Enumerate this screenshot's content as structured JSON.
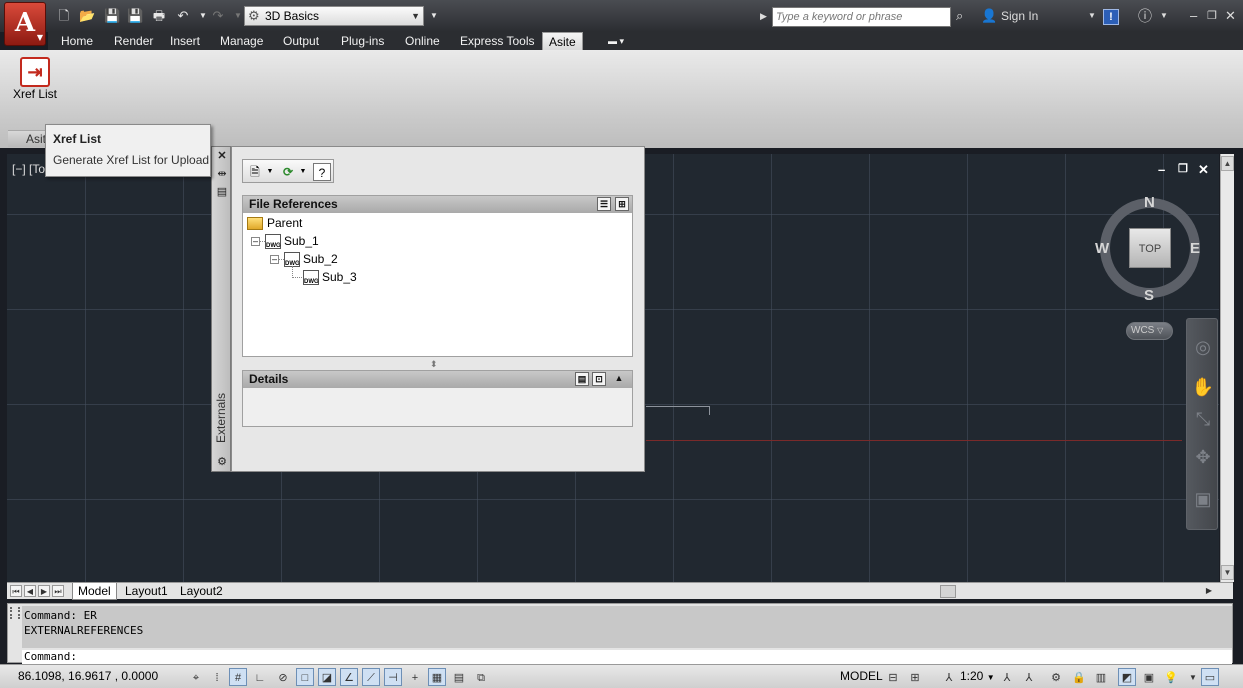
{
  "app": {
    "logo_letter": "A",
    "workspace": "3D Basics",
    "search_placeholder": "Type a keyword or phrase",
    "sign_in": "Sign In"
  },
  "ribbon": {
    "tabs": [
      "Home",
      "Render",
      "Insert",
      "Manage",
      "Output",
      "Plug-ins",
      "Online",
      "Express Tools",
      "Asite"
    ],
    "active_tab": "Asite",
    "xref_button_label": "Xref List",
    "panel_label": "Asite"
  },
  "tooltip": {
    "title": "Xref List",
    "description": "Generate Xref List for Upload"
  },
  "viewport": {
    "label": "[−] [To",
    "viewcube": {
      "top": "TOP",
      "north": "N",
      "south": "S",
      "east": "E",
      "west": "W"
    },
    "ucs": "WCS"
  },
  "palette": {
    "title": "Externals",
    "file_references_header": "File References",
    "tree": [
      {
        "name": "Parent",
        "level": 0
      },
      {
        "name": "Sub_1",
        "level": 1
      },
      {
        "name": "Sub_2",
        "level": 2
      },
      {
        "name": "Sub_3",
        "level": 3
      }
    ],
    "details_header": "Details",
    "dwg_badge": "DWG"
  },
  "layouts": {
    "tabs": [
      "Model",
      "Layout1",
      "Layout2"
    ],
    "active": "Model"
  },
  "command": {
    "history": [
      "Command: ER",
      "EXTERNALREFERENCES"
    ],
    "prompt": "Command:"
  },
  "status": {
    "coordinates": "86.1098, 16.9617 , 0.0000",
    "space": "MODEL",
    "annotation_scale": "1:20"
  },
  "colors": {
    "drawing_bg": "#212830",
    "accent_red": "#c32a1e",
    "ribbon_bg": "#d6d6d6"
  }
}
